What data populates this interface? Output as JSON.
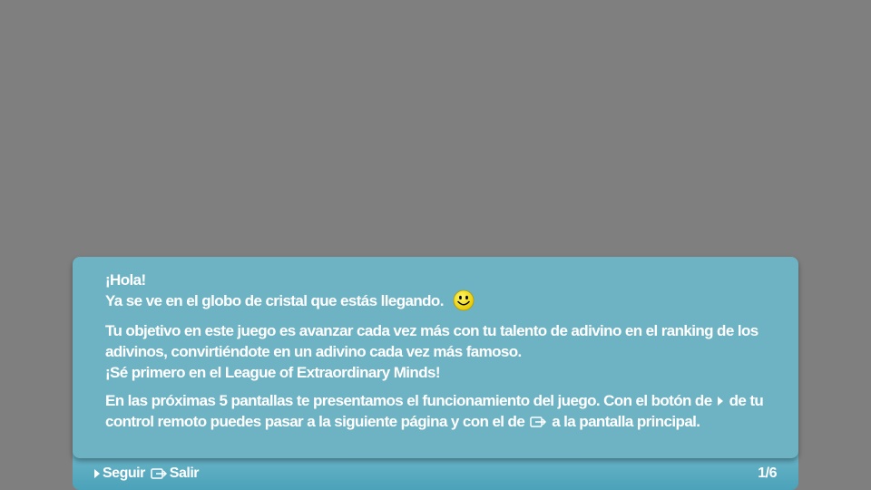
{
  "colors": {
    "background": "#7f7f7f",
    "panel": "#6eb3c4",
    "footer_bar": "#4ba2b9",
    "text": "#ffffff",
    "smiley": "#f5e10a"
  },
  "dialog": {
    "greeting": "¡Hola!",
    "line2": "Ya se ve en el globo de cristal que estás llegando.",
    "para2_line1": "Tu objetivo en este juego es avanzar cada vez más con tu talento de adivino en el ranking de los",
    "para2_line2": "adivinos, convirtiéndote en un adivino cada vez más famoso.",
    "para2_line3": "¡Sé primero en el League of Extraordinary Minds!",
    "para3_part1": "En las próximas 5 pantallas te presentamos el funcionamiento del juego. Con el botón de",
    "para3_part2": "de tu",
    "para3_part3": "control remoto puedes pasar a la siguiente página y con el de",
    "para3_part4": "a la pantalla principal.",
    "smiley_icon": "smiley-icon"
  },
  "footer": {
    "next_label": "Seguir",
    "exit_label": "Salir",
    "page_indicator": "1/6",
    "next_icon": "play-arrow-icon",
    "exit_icon": "exit-icon"
  }
}
